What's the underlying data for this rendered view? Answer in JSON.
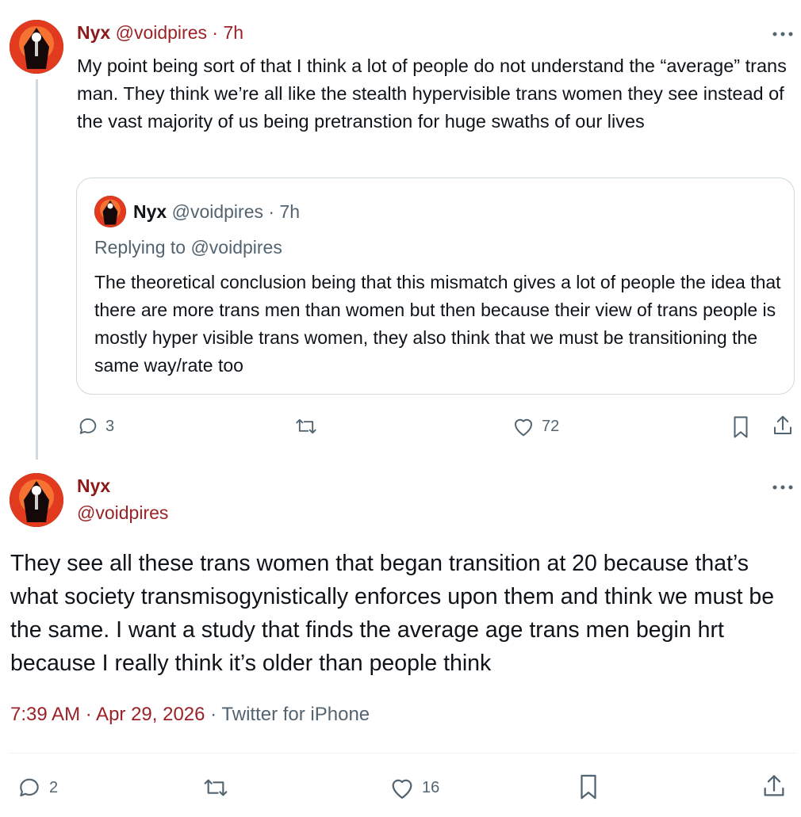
{
  "parent_tweet": {
    "author_name": "Nyx",
    "handle": "@voidpires",
    "time": "· 7h",
    "more_icon": "more-horizontal-icon",
    "text": "My point being sort of that I think a lot of people do not understand the “average” trans man. They think we’re all like the stealth hypervisible trans women they see instead of the vast majority of us being pretranstion for huge swaths of our lives",
    "quoted_tweet": {
      "author_name": "Nyx",
      "handle": "@voidpires",
      "time": "· 7h",
      "replying_to": "Replying to @voidpires",
      "text": "The theoretical conclusion being that this mismatch gives a lot of people the idea that there are more trans men than women but then because their view of trans people is mostly hyper visible trans women, they also think that we must be transitioning the same way/rate too"
    },
    "actions": {
      "replies": "3",
      "retweets": "",
      "likes": "72"
    }
  },
  "main_tweet": {
    "author_name": "Nyx",
    "handle": "@voidpires",
    "text": "They see all these trans women that began transition at 20 because that’s what society transmisogynistically enforces upon them and think we must be the same. I want a study that finds the average age trans men begin hrt because I really think it’s older than people think",
    "timestamp": "7:39 AM · Apr 29, 2026",
    "source": "· Twitter for iPhone",
    "actions": {
      "replies": "2",
      "retweets": "",
      "likes": "16"
    }
  },
  "colors": {
    "accent_name": "#8b1a1a",
    "text": "#0f1419",
    "muted": "#536471",
    "border": "#cfd9de"
  }
}
